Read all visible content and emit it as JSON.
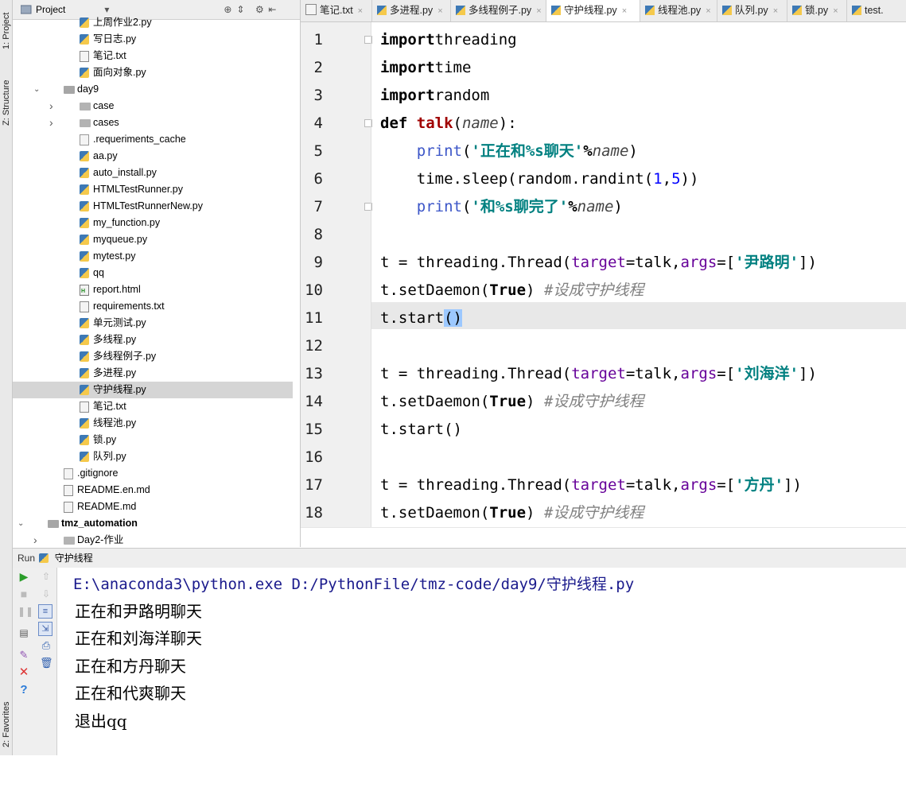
{
  "left_strip": {
    "project_tab": "1: Project",
    "structure_tab": "Z: Structure",
    "favorites_tab": "2: Favorites"
  },
  "project_panel": {
    "title": "Project",
    "tree": [
      {
        "label": "上周作业2.py",
        "type": "py",
        "level": 3
      },
      {
        "label": "写日志.py",
        "type": "py",
        "level": 3
      },
      {
        "label": "笔记.txt",
        "type": "txt",
        "level": 3
      },
      {
        "label": "面向对象.py",
        "type": "py",
        "level": 3
      },
      {
        "label": "day9",
        "type": "folder-open",
        "level": 2
      },
      {
        "label": "case",
        "type": "folder",
        "level": 3
      },
      {
        "label": "cases",
        "type": "folder",
        "level": 3
      },
      {
        "label": ".requeriments_cache",
        "type": "gen",
        "level": 3
      },
      {
        "label": "aa.py",
        "type": "py",
        "level": 3
      },
      {
        "label": "auto_install.py",
        "type": "py",
        "level": 3
      },
      {
        "label": "HTMLTestRunner.py",
        "type": "py",
        "level": 3
      },
      {
        "label": "HTMLTestRunnerNew.py",
        "type": "py",
        "level": 3
      },
      {
        "label": "my_function.py",
        "type": "py",
        "level": 3
      },
      {
        "label": "myqueue.py",
        "type": "py",
        "level": 3
      },
      {
        "label": "mytest.py",
        "type": "py",
        "level": 3
      },
      {
        "label": "qq",
        "type": "py",
        "level": 3
      },
      {
        "label": "report.html",
        "type": "html",
        "level": 3
      },
      {
        "label": "requirements.txt",
        "type": "txt",
        "level": 3
      },
      {
        "label": "单元测试.py",
        "type": "py",
        "level": 3
      },
      {
        "label": "多线程.py",
        "type": "py",
        "level": 3
      },
      {
        "label": "多线程例子.py",
        "type": "py",
        "level": 3
      },
      {
        "label": "多进程.py",
        "type": "py",
        "level": 3
      },
      {
        "label": "守护线程.py",
        "type": "py",
        "level": 3,
        "selected": true
      },
      {
        "label": "笔记.txt",
        "type": "txt",
        "level": 3
      },
      {
        "label": "线程池.py",
        "type": "py",
        "level": 3
      },
      {
        "label": "锁.py",
        "type": "py",
        "level": 3
      },
      {
        "label": "队列.py",
        "type": "py",
        "level": 3
      },
      {
        "label": ".gitignore",
        "type": "gen",
        "level": 2
      },
      {
        "label": "README.en.md",
        "type": "txt",
        "level": 2
      },
      {
        "label": "README.md",
        "type": "txt",
        "level": 2
      },
      {
        "label": "tmz_automation",
        "type": "folder-open",
        "level": 1,
        "bold": true
      },
      {
        "label": "Day2-作业",
        "type": "folder",
        "level": 2
      }
    ]
  },
  "tabs": [
    {
      "label": "笔记.txt",
      "type": "txt"
    },
    {
      "label": "多进程.py",
      "type": "py"
    },
    {
      "label": "多线程例子.py",
      "type": "py"
    },
    {
      "label": "守护线程.py",
      "type": "py",
      "active": true
    },
    {
      "label": "线程池.py",
      "type": "py"
    },
    {
      "label": "队列.py",
      "type": "py"
    },
    {
      "label": "锁.py",
      "type": "py"
    },
    {
      "label": "test.",
      "type": "py"
    }
  ],
  "editor": {
    "line_numbers": [
      "1",
      "2",
      "3",
      "4",
      "5",
      "6",
      "7",
      "8",
      "9",
      "10",
      "11",
      "12",
      "13",
      "14",
      "15",
      "16",
      "17",
      "18"
    ],
    "current_line": 11,
    "lines": [
      [
        [
          "kwb",
          "import"
        ],
        [
          "",
          "threading"
        ]
      ],
      [
        [
          "kwb",
          "import"
        ],
        [
          "",
          "time"
        ]
      ],
      [
        [
          "kwb",
          "import"
        ],
        [
          "",
          "random"
        ]
      ],
      [
        [
          "kwb",
          "def "
        ],
        [
          "def-name",
          "talk"
        ],
        [
          "",
          "("
        ],
        [
          "param",
          "name"
        ],
        [
          "",
          "):"
        ]
      ],
      [
        [
          "",
          "    "
        ],
        [
          "printfn",
          "print"
        ],
        [
          "",
          "("
        ],
        [
          "str",
          "'正在和%s聊天'"
        ],
        [
          "kwb",
          "%"
        ],
        [
          "param",
          "name"
        ],
        [
          "",
          ")"
        ]
      ],
      [
        [
          "",
          "    time.sleep(random.randint("
        ],
        [
          "num",
          "1"
        ],
        [
          "",
          ","
        ],
        [
          "num",
          "5"
        ],
        [
          "",
          "))"
        ]
      ],
      [
        [
          "",
          "    "
        ],
        [
          "printfn",
          "print"
        ],
        [
          "",
          "("
        ],
        [
          "str",
          "'和%s聊完了'"
        ],
        [
          "kwb",
          "%"
        ],
        [
          "param",
          "name"
        ],
        [
          "",
          ")"
        ]
      ],
      [],
      [
        [
          "",
          "t = threading.Thread("
        ],
        [
          "kwarg",
          "target"
        ],
        [
          "",
          "=talk,"
        ],
        [
          "kwarg",
          "args"
        ],
        [
          "",
          "=["
        ],
        [
          "str",
          "'尹路明'"
        ],
        [
          "",
          "])"
        ]
      ],
      [
        [
          "",
          "t.setDaemon("
        ],
        [
          "kwb",
          "True"
        ],
        [
          "",
          ") "
        ],
        [
          "cm",
          "#设成守护线程"
        ]
      ],
      [
        [
          "",
          "t.start"
        ],
        [
          "brk",
          "()"
        ]
      ],
      [],
      [
        [
          "",
          "t = threading.Thread("
        ],
        [
          "kwarg",
          "target"
        ],
        [
          "",
          "=talk,"
        ],
        [
          "kwarg",
          "args"
        ],
        [
          "",
          "=["
        ],
        [
          "str",
          "'刘海洋'"
        ],
        [
          "",
          "])"
        ]
      ],
      [
        [
          "",
          "t.setDaemon("
        ],
        [
          "kwb",
          "True"
        ],
        [
          "",
          ") "
        ],
        [
          "cm",
          "#设成守护线程"
        ]
      ],
      [
        [
          "",
          "t.start()"
        ]
      ],
      [],
      [
        [
          "",
          "t = threading.Thread("
        ],
        [
          "kwarg",
          "target"
        ],
        [
          "",
          "=talk,"
        ],
        [
          "kwarg",
          "args"
        ],
        [
          "",
          "=["
        ],
        [
          "str",
          "'方丹'"
        ],
        [
          "",
          "])"
        ]
      ],
      [
        [
          "",
          "t.setDaemon("
        ],
        [
          "kwb",
          "True"
        ],
        [
          "",
          ") "
        ],
        [
          "cm",
          "#设成守护线程"
        ]
      ]
    ]
  },
  "run_panel": {
    "label": "Run",
    "config": "守护线程",
    "output": [
      "E:\\anaconda3\\python.exe D:/PythonFile/tmz-code/day9/守护线程.py",
      "正在和尹路明聊天",
      "正在和刘海洋聊天",
      "正在和方丹聊天",
      "正在和代爽聊天",
      "退出qq"
    ]
  }
}
